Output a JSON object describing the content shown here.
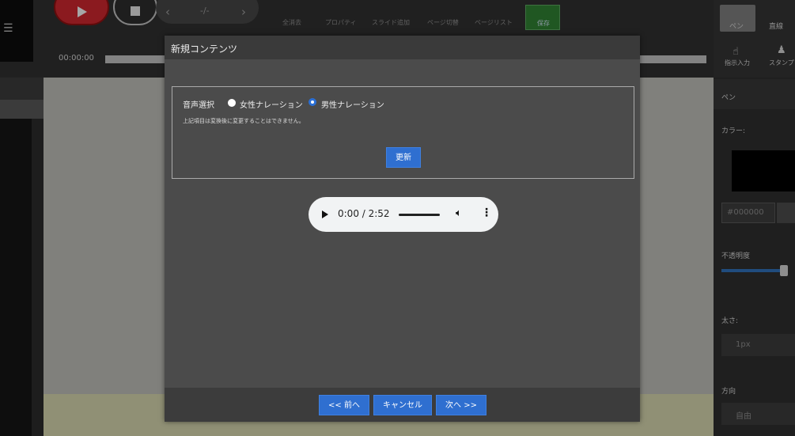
{
  "toolbar": {
    "undo_redo_sep": "-/-",
    "labels": [
      "全消去",
      "プロパティ",
      "スライド追加",
      "ページ切替",
      "ページリスト",
      "保存"
    ],
    "timecode": "00:00:00"
  },
  "right_panel": {
    "tools": [
      "ペン",
      "直線",
      "指示入力",
      "スタンプ"
    ],
    "section_title": "ペン",
    "color_label": "カラー:",
    "color_value": "#000000",
    "opacity_label": "不透明度",
    "opacity_level": 0.95,
    "thickness_label": "太さ:",
    "thickness_value": "1px",
    "direction_label": "方向",
    "direction_value": "自由"
  },
  "modal": {
    "title": "新規コンテンツ",
    "voice_label": "音声選択",
    "options": [
      {
        "label": "女性ナレーション",
        "selected": false
      },
      {
        "label": "男性ナレーション",
        "selected": true
      }
    ],
    "note": "上記項目は変換後に変更することはできません。",
    "update_button": "更新",
    "audio": {
      "time": "0:00 / 2:52",
      "progress": 0.0
    },
    "footer": {
      "prev": "<< 前へ",
      "cancel": "キャンセル",
      "next": "次へ >>"
    }
  },
  "colors": {
    "accent": "#2f6fd0",
    "record": "#c7262d",
    "save": "#2e7d32"
  }
}
